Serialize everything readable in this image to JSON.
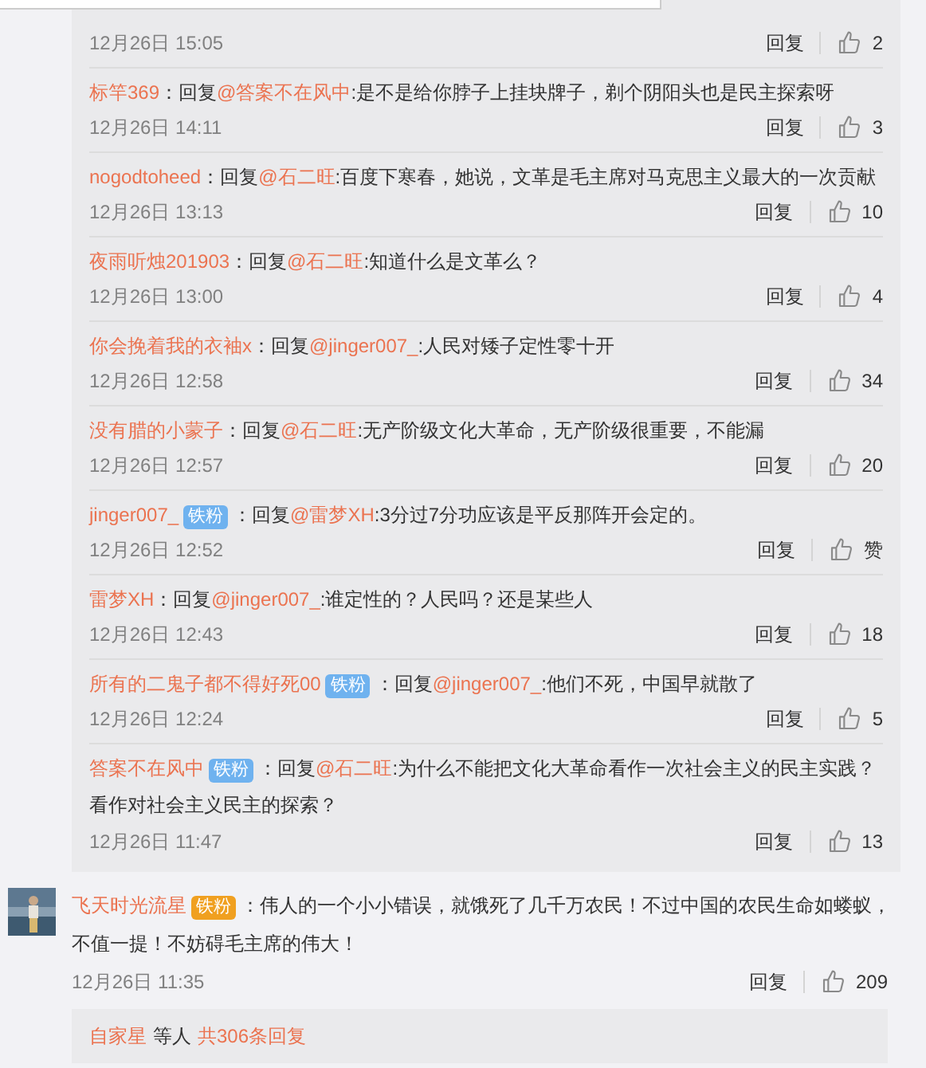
{
  "replies": [
    {
      "time": "12月26日 15:05",
      "reply_label": "回复",
      "likes": "2"
    },
    {
      "user": "标竿369",
      "prefix": "：回复",
      "mention": "@答案不在风中",
      "text": ":是不是给你脖子上挂块牌子，剃个阴阳头也是民主探索呀",
      "time": "12月26日 14:11",
      "reply_label": "回复",
      "likes": "3"
    },
    {
      "user": "nogodtoheed",
      "prefix": "：回复",
      "mention": "@石二旺",
      "text": ":百度下寒春，她说，文革是毛主席对马克思主义最大的一次贡献",
      "time": "12月26日 13:13",
      "reply_label": "回复",
      "likes": "10"
    },
    {
      "user": "夜雨听烛201903",
      "prefix": "：回复",
      "mention": "@石二旺",
      "text": ":知道什么是文革么？",
      "time": "12月26日 13:00",
      "reply_label": "回复",
      "likes": "4"
    },
    {
      "user": "你会挽着我的衣袖x",
      "prefix": "：回复",
      "mention": "@jinger007_",
      "text": ":人民对矮子定性零十开",
      "time": "12月26日 12:58",
      "reply_label": "回复",
      "likes": "34"
    },
    {
      "user": "没有腊的小蒙子",
      "prefix": "：回复",
      "mention": "@石二旺",
      "text": ":无产阶级文化大革命，无产阶级很重要，不能漏",
      "time": "12月26日 12:57",
      "reply_label": "回复",
      "likes": "20"
    },
    {
      "user": "jinger007_",
      "badge": "铁粉",
      "prefix": "：回复",
      "mention": "@雷梦XH",
      "text": ":3分过7分功应该是平反那阵开会定的。",
      "time": "12月26日 12:52",
      "reply_label": "回复",
      "likes": "赞"
    },
    {
      "user": "雷梦XH",
      "prefix": "：回复",
      "mention": "@jinger007_",
      "text": ":谁定性的？人民吗？还是某些人",
      "time": "12月26日 12:43",
      "reply_label": "回复",
      "likes": "18"
    },
    {
      "user": "所有的二鬼子都不得好死00",
      "badge": "铁粉",
      "prefix": "：回复",
      "mention": "@jinger007_",
      "text": ":他们不死，中国早就散了",
      "time": "12月26日 12:24",
      "reply_label": "回复",
      "likes": "5"
    },
    {
      "user": "答案不在风中",
      "badge": "铁粉",
      "prefix": "：回复",
      "mention": "@石二旺",
      "text": ":为什么不能把文化大革命看作一次社会主义的民主实践？",
      "text_continued": "看作对社会主义民主的探索？",
      "time": "12月26日 11:47",
      "reply_label": "回复",
      "likes": "13"
    }
  ],
  "comment": {
    "user": "飞天时光流星",
    "badge": "铁粉",
    "text": "：伟人的一个小小错误，就饿死了几千万农民！不过中国的农民生命如蝼蚁，",
    "text_continued": "不值一提！不妨碍毛主席的伟大！",
    "time": "12月26日 11:35",
    "reply_label": "回复",
    "likes": "209",
    "more": {
      "user": "自家星",
      "middle": "等人",
      "count_link": "共306条回复"
    }
  }
}
